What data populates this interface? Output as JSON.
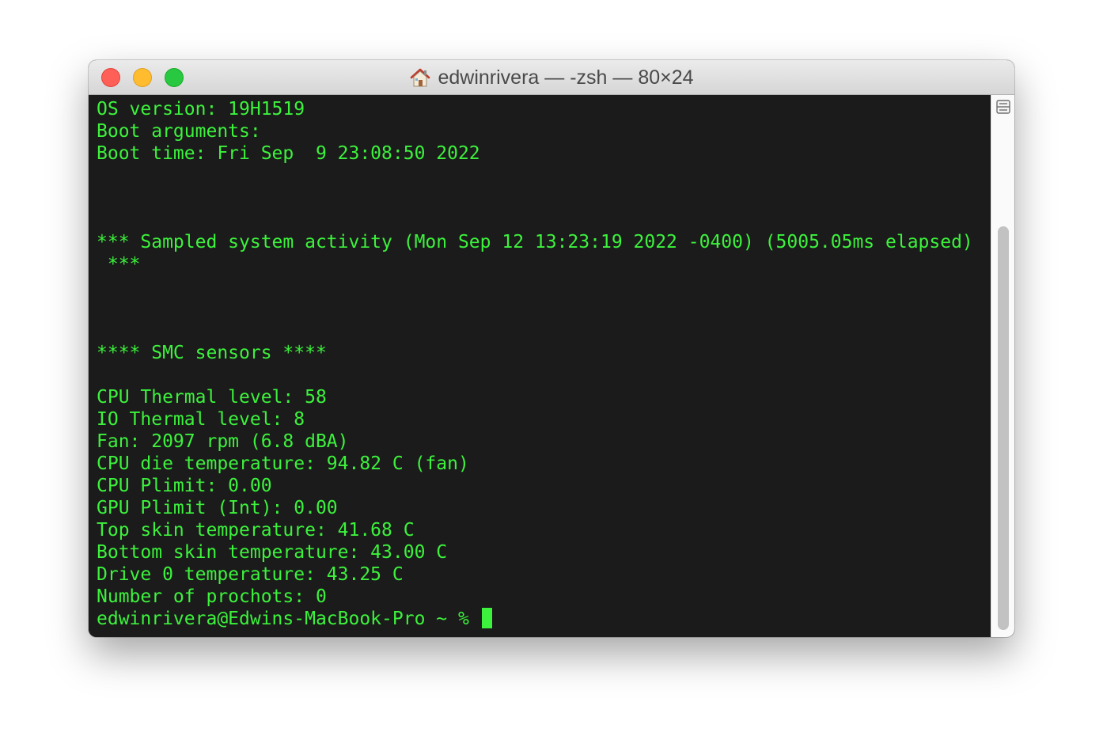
{
  "window": {
    "title": "edwinrivera — -zsh — 80×24",
    "title_icon": "home-icon"
  },
  "colors": {
    "terminal_background": "#1b1b1b",
    "terminal_text": "#3cf23c",
    "close": "#fe5f57",
    "minimize": "#febc2e",
    "zoom": "#28c840"
  },
  "terminal": {
    "lines": [
      "OS version: 19H1519",
      "Boot arguments:",
      "Boot time: Fri Sep  9 23:08:50 2022",
      "",
      "",
      "",
      "*** Sampled system activity (Mon Sep 12 13:23:19 2022 -0400) (5005.05ms elapsed)",
      " ***",
      "",
      "",
      "",
      "**** SMC sensors ****",
      "",
      "CPU Thermal level: 58",
      "IO Thermal level: 8",
      "Fan: 2097 rpm (6.8 dBA)",
      "CPU die temperature: 94.82 C (fan)",
      "CPU Plimit: 0.00",
      "GPU Plimit (Int): 0.00",
      "Top skin temperature: 41.68 C",
      "Bottom skin temperature: 43.00 C",
      "Drive 0 temperature: 43.25 C",
      "Number of prochots: 0"
    ],
    "prompt": "edwinrivera@Edwins-MacBook-Pro ~ % "
  }
}
